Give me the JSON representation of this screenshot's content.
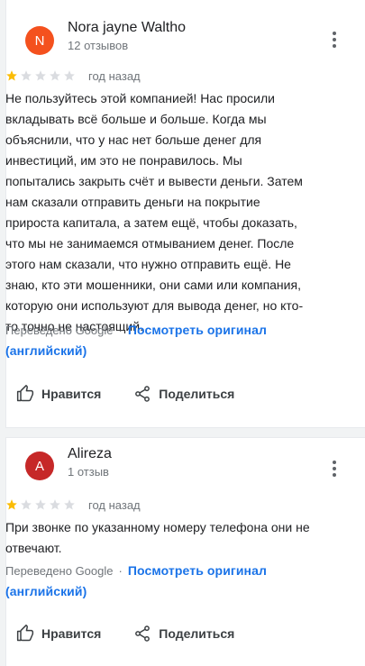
{
  "colors": {
    "avatar_1": "#f4511e",
    "avatar_2": "#c62828",
    "star_filled": "#fbbc04",
    "star_empty": "#dadce0",
    "link": "#1a73e8"
  },
  "reviews": [
    {
      "avatar_letter": "N",
      "author": "Nora jayne Waltho",
      "review_count": "12 отзывов",
      "rating": 1,
      "date": "год назад",
      "text": "Не пользуйтесь этой компанией! Нас просили\nвкладывать всё больше и больше. Когда мы\nобъяснили, что у нас нет больше денег для\nинвестиций, им это не понравилось. Мы\nпопытались закрыть счёт и вывести деньги. Затем\nнам сказали отправить деньги на покрытие\nприроста капитала, а затем ещё, чтобы доказать,\nчто мы не занимаемся отмыванием денег. После\nэтого нам сказали, что нужно отправить ещё. Не\nзнаю, кто эти мошенники, они сами или компания,\nкоторую они используют для вывода денег, но кто-\nто точно не настоящий.",
      "translated_by": "Переведено Google",
      "separator": "·",
      "view_original": "Посмотреть оригинал",
      "view_original_lang": "(английский)",
      "like_label": "Нравится",
      "share_label": "Поделиться"
    },
    {
      "avatar_letter": "A",
      "author": "Alireza",
      "review_count": "1 отзыв",
      "rating": 1,
      "date": "год назад",
      "text": "При звонке по указанному номеру телефона они не\nотвечают.",
      "translated_by": "Переведено Google",
      "separator": "·",
      "view_original": "Посмотреть оригинал",
      "view_original_lang": "(английский)",
      "like_label": "Нравится",
      "share_label": "Поделиться"
    }
  ],
  "icons": {
    "more": "more-vert-icon",
    "like": "thumb-up-icon",
    "share": "share-icon",
    "star": "star-icon"
  }
}
